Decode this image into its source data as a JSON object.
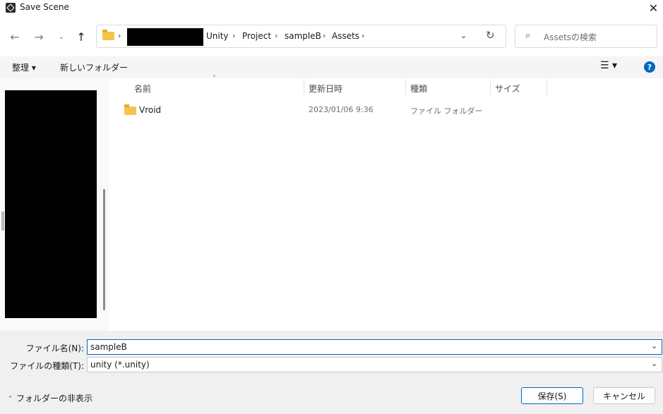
{
  "window": {
    "title": "Save Scene",
    "close_glyph": "✕"
  },
  "nav": {
    "back_glyph": "←",
    "forward_glyph": "→",
    "recent_glyph": "⌄",
    "up_glyph": "↑",
    "refresh_glyph": "↻",
    "dropdown_glyph": "⌄"
  },
  "address": {
    "crumbs": [
      "Unity",
      "Project",
      "sampleB",
      "Assets"
    ],
    "separator": "›"
  },
  "search": {
    "placeholder": "Assetsの検索",
    "icon": "⌕"
  },
  "toolbar": {
    "organize_label": "整理 ▾",
    "new_folder_label": "新しいフォルダー",
    "view_glyph": "☰ ▾",
    "help_glyph": "?"
  },
  "columns": {
    "name": "名前",
    "modified": "更新日時",
    "type": "種類",
    "size": "サイズ",
    "sort_glyph": "˄"
  },
  "files": [
    {
      "name": "Vroid",
      "modified": "2023/01/06 9:36",
      "type": "ファイル フォルダー",
      "size": ""
    }
  ],
  "form": {
    "filename_label": "ファイル名(N):",
    "filename_value": "sampleB",
    "filetype_label": "ファイルの種類(T):",
    "filetype_value": "unity (*.unity)",
    "dropdown_glyph": "⌄"
  },
  "footer": {
    "hide_folders_label": "フォルダーの非表示",
    "hide_chevron": "˄",
    "save_label": "保存(S)",
    "cancel_label": "キャンセル"
  },
  "colors": {
    "accent": "#0067c0",
    "folder": "#f5c44c"
  }
}
